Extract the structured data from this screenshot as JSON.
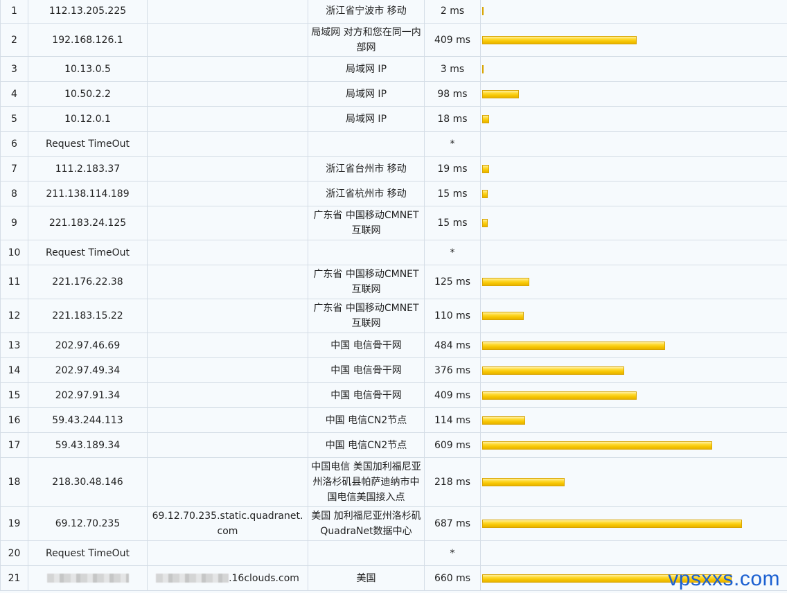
{
  "rows": [
    {
      "hop": "1",
      "ip": "112.13.205.225",
      "host": "",
      "geo": "浙江省宁波市 移动",
      "time": "2 ms",
      "ms": 2
    },
    {
      "hop": "2",
      "ip": "192.168.126.1",
      "host": "",
      "geo": "局域网 对方和您在同一内部网",
      "time": "409 ms",
      "ms": 409
    },
    {
      "hop": "3",
      "ip": "10.13.0.5",
      "host": "",
      "geo": "局域网 IP",
      "time": "3 ms",
      "ms": 3
    },
    {
      "hop": "4",
      "ip": "10.50.2.2",
      "host": "",
      "geo": "局域网 IP",
      "time": "98 ms",
      "ms": 98
    },
    {
      "hop": "5",
      "ip": "10.12.0.1",
      "host": "",
      "geo": "局域网 IP",
      "time": "18 ms",
      "ms": 18
    },
    {
      "hop": "6",
      "ip": "Request TimeOut",
      "host": "",
      "geo": "",
      "time": "*",
      "ms": 0
    },
    {
      "hop": "7",
      "ip": "111.2.183.37",
      "host": "",
      "geo": "浙江省台州市 移动",
      "time": "19 ms",
      "ms": 19
    },
    {
      "hop": "8",
      "ip": "211.138.114.189",
      "host": "",
      "geo": "浙江省杭州市 移动",
      "time": "15 ms",
      "ms": 15
    },
    {
      "hop": "9",
      "ip": "221.183.24.125",
      "host": "",
      "geo": "广东省 中国移动CMNET互联网",
      "time": "15 ms",
      "ms": 15
    },
    {
      "hop": "10",
      "ip": "Request TimeOut",
      "host": "",
      "geo": "",
      "time": "*",
      "ms": 0
    },
    {
      "hop": "11",
      "ip": "221.176.22.38",
      "host": "",
      "geo": "广东省 中国移动CMNET互联网",
      "time": "125 ms",
      "ms": 125
    },
    {
      "hop": "12",
      "ip": "221.183.15.22",
      "host": "",
      "geo": "广东省 中国移动CMNET互联网",
      "time": "110 ms",
      "ms": 110
    },
    {
      "hop": "13",
      "ip": "202.97.46.69",
      "host": "",
      "geo": "中国 电信骨干网",
      "time": "484 ms",
      "ms": 484
    },
    {
      "hop": "14",
      "ip": "202.97.49.34",
      "host": "",
      "geo": "中国 电信骨干网",
      "time": "376 ms",
      "ms": 376
    },
    {
      "hop": "15",
      "ip": "202.97.91.34",
      "host": "",
      "geo": "中国 电信骨干网",
      "time": "409 ms",
      "ms": 409
    },
    {
      "hop": "16",
      "ip": "59.43.244.113",
      "host": "",
      "geo": "中国 电信CN2节点",
      "time": "114 ms",
      "ms": 114
    },
    {
      "hop": "17",
      "ip": "59.43.189.34",
      "host": "",
      "geo": "中国 电信CN2节点",
      "time": "609 ms",
      "ms": 609
    },
    {
      "hop": "18",
      "ip": "218.30.48.146",
      "host": "",
      "geo": "中国电信 美国加利福尼亚州洛杉矶县帕萨迪纳市中国电信美国接入点",
      "time": "218 ms",
      "ms": 218
    },
    {
      "hop": "19",
      "ip": "69.12.70.235",
      "host": "69.12.70.235.static.quadranet.com",
      "geo": "美国 加利福尼亚州洛杉矶QuadraNet数据中心",
      "time": "687 ms",
      "ms": 687
    },
    {
      "hop": "20",
      "ip": "Request TimeOut",
      "host": "",
      "geo": "",
      "time": "*",
      "ms": 0
    },
    {
      "hop": "21",
      "ip": "",
      "host": ".16clouds.com",
      "geo": "美国",
      "time": "660 ms",
      "ms": 660
    }
  ],
  "bar_max_ms": 687,
  "colors": {
    "bar": "#f5c400",
    "border": "#d4dde6",
    "watermark": "#1a5fd1"
  },
  "watermark": "vpsxxs.com"
}
